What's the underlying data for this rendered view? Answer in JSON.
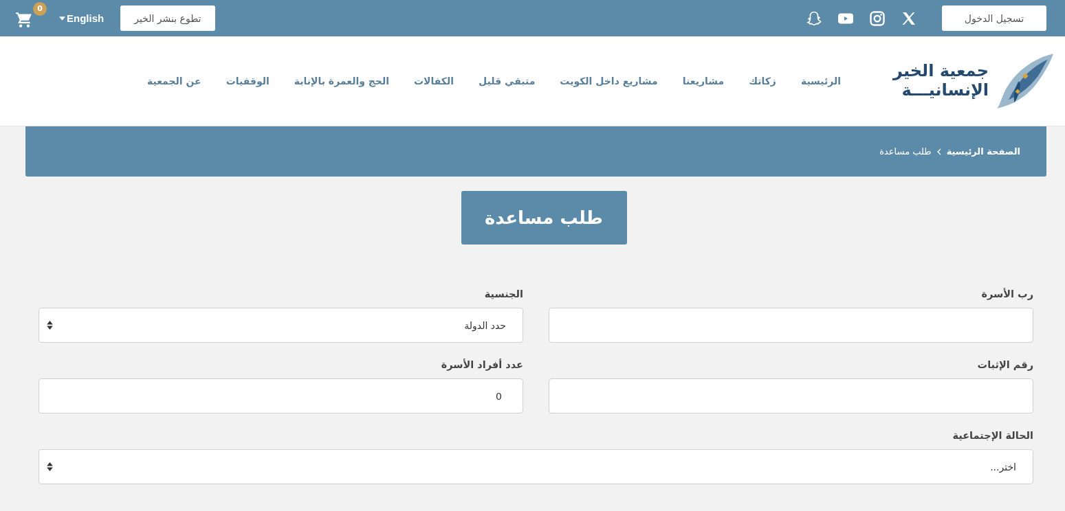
{
  "top_bar": {
    "login_button": "تسجيل الدخول",
    "social": [
      {
        "kind": "x"
      },
      {
        "kind": "instagram"
      },
      {
        "kind": "youtube"
      },
      {
        "kind": "snapchat"
      }
    ],
    "volunteer_button": "تطوع بنشر الخير",
    "language": "English",
    "cart_count": "0"
  },
  "header": {
    "logo": {
      "line_1": "جمعية الخير",
      "line_2": "الإنسانيـــة"
    },
    "nav": [
      "الرئيسية",
      "زكاتك",
      "مشاريعنا",
      "مشاريع داخل الكويت",
      "متبقي قليل",
      "الكفالات",
      "الحج والعمرة بالإنابة",
      "الوقفيات",
      "عن الجمعية"
    ]
  },
  "breadcrumb": [
    {
      "label": "الصفحة الرئيسية",
      "current": false
    },
    {
      "label": "طلب مساعدة",
      "current": true
    }
  ],
  "page_title": "طلب مساعدة",
  "form": {
    "fields": [
      {
        "kind": "text",
        "label": "رب الأسرة",
        "wide": false
      },
      {
        "kind": "select",
        "label": "الجنسية",
        "value": "حدد الدولة",
        "wide": false
      },
      {
        "kind": "text",
        "label": "رقم الإثبات",
        "wide": false
      },
      {
        "kind": "text",
        "label": "عدد أفراد الأسرة",
        "value": "0",
        "wide": false
      },
      {
        "kind": "select",
        "label": "الحالة الإجتماعية",
        "value": "اختر...",
        "wide": true
      }
    ]
  }
}
